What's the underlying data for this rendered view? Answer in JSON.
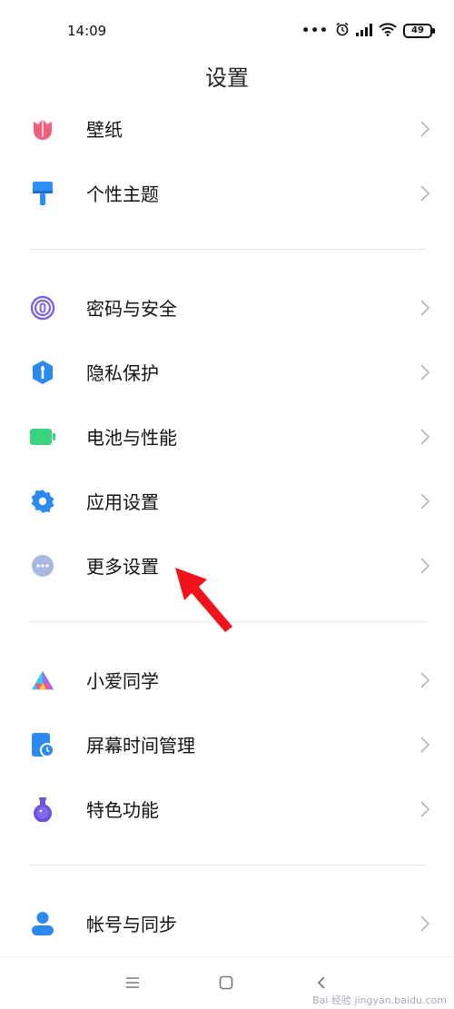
{
  "status": {
    "time": "14:09",
    "battery": "49"
  },
  "header": {
    "title": "设置"
  },
  "groups": [
    [
      {
        "label": "壁纸",
        "icon": "tulip-icon"
      },
      {
        "label": "个性主题",
        "icon": "paint-brush-icon"
      }
    ],
    [
      {
        "label": "密码与安全",
        "icon": "fingerprint-icon"
      },
      {
        "label": "隐私保护",
        "icon": "privacy-shield-icon"
      },
      {
        "label": "电池与性能",
        "icon": "battery-icon"
      },
      {
        "label": "应用设置",
        "icon": "gear-icon"
      },
      {
        "label": "更多设置",
        "icon": "more-dots-icon"
      }
    ],
    [
      {
        "label": "小爱同学",
        "icon": "xiaoai-icon"
      },
      {
        "label": "屏幕时间管理",
        "icon": "screen-time-icon"
      },
      {
        "label": "特色功能",
        "icon": "flask-icon"
      }
    ],
    [
      {
        "label": "帐号与同步",
        "icon": "account-icon"
      }
    ]
  ],
  "colors": {
    "tulip": "#f0607a",
    "brush": "#2f8ff5",
    "fingerprint": "#7a63e8",
    "privacy": "#2a8af0",
    "battery": "#39d47f",
    "gear": "#2a8af0",
    "more": "#a8b8e0",
    "account": "#2a8af0",
    "arrow": "#f0141a"
  },
  "footer": {
    "watermark": "Bai 经验 jingyan.baidu.com"
  }
}
